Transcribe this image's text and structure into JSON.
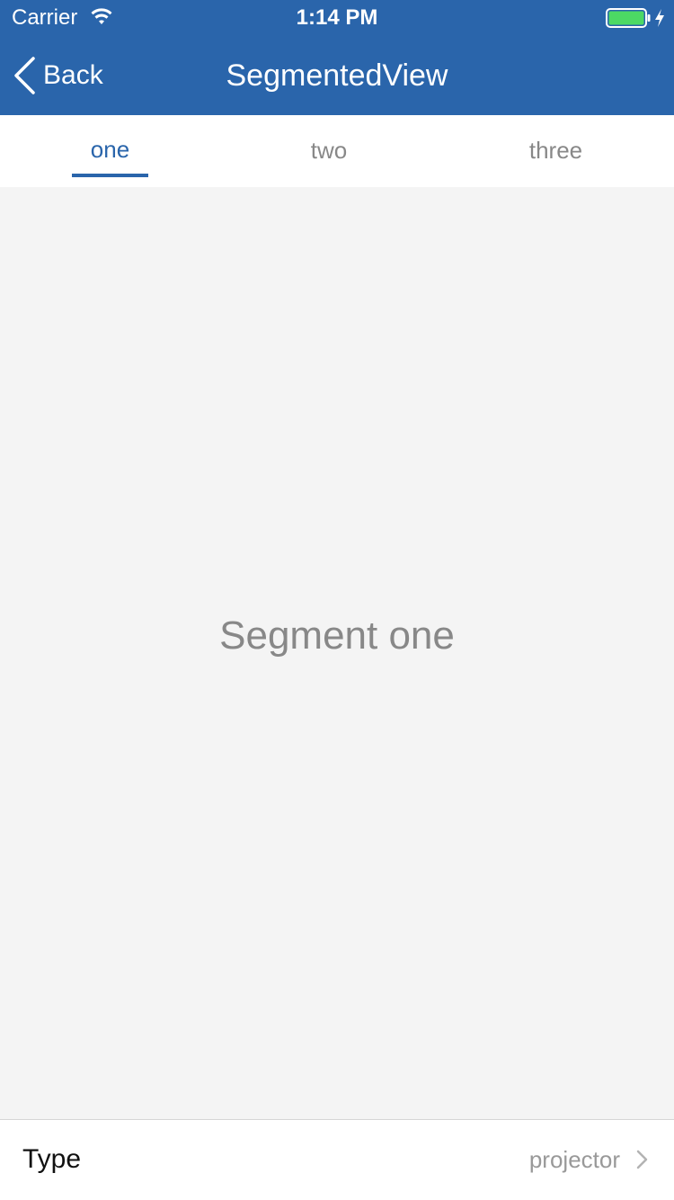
{
  "status_bar": {
    "carrier": "Carrier",
    "time": "1:14 PM",
    "wifi_icon": "wifi-icon",
    "battery_icon": "battery-full-icon",
    "charging_icon": "charging-bolt-icon",
    "battery_level": 1.0
  },
  "nav": {
    "back_label": "Back",
    "title": "SegmentedView",
    "back_icon": "chevron-left-icon"
  },
  "tabs": [
    {
      "label": "one",
      "active": true
    },
    {
      "label": "two",
      "active": false
    },
    {
      "label": "three",
      "active": false
    }
  ],
  "content": {
    "segment_text": "Segment one"
  },
  "type_row": {
    "label": "Type",
    "value": "projector",
    "icon": "chevron-right-icon"
  },
  "colors": {
    "primary": "#2a65ab",
    "background": "#f4f4f4",
    "battery_fill": "#4cd964",
    "muted_text": "#888888"
  }
}
